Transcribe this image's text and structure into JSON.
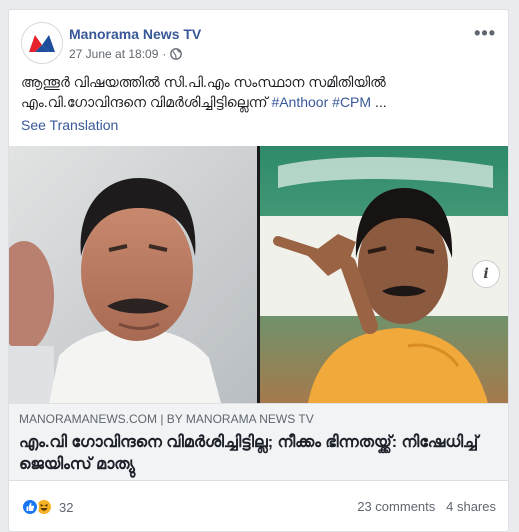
{
  "post": {
    "page_name": "Manorama News TV",
    "timestamp": "27 June at 18:09",
    "separator": "·",
    "text_line1": "ആന്തൂർ വിഷയത്തിൽ സി.പി.എം സംസ്ഥാന സമിതിയിൽ",
    "text_line2": "എം.വി.ഗോവിന്ദനെ വിമർശിച്ചിട്ടില്ലെന്ന്",
    "hashtag1": "#Anthoor",
    "hashtag2": "#CPM",
    "ellipsis": "...",
    "see_translation": "See Translation",
    "more_label": "•••"
  },
  "link": {
    "source": "MANORAMANEWS.COM | BY MANORAMA NEWS TV",
    "title": "എം.വി ഗോവിന്ദനെ വിമർശിച്ചിട്ടില്ല; നീക്കം ഭിന്നതയ്ക്ക്: നിഷേധിച്ച് ജെയിംസ് മാത്യു",
    "info_label": "i"
  },
  "stats": {
    "reactions_count": "32",
    "comments": "23 comments",
    "shares": "4 shares"
  },
  "colors": {
    "link_blue": "#385898",
    "like_blue": "#1877f2",
    "haha_yellow": "#f7b125",
    "brand_red": "#e62129",
    "brand_blue": "#1f4e9c"
  },
  "icons": [
    "globe-icon",
    "more-icon",
    "info-icon",
    "like-icon",
    "haha-icon",
    "manorama-logo"
  ]
}
